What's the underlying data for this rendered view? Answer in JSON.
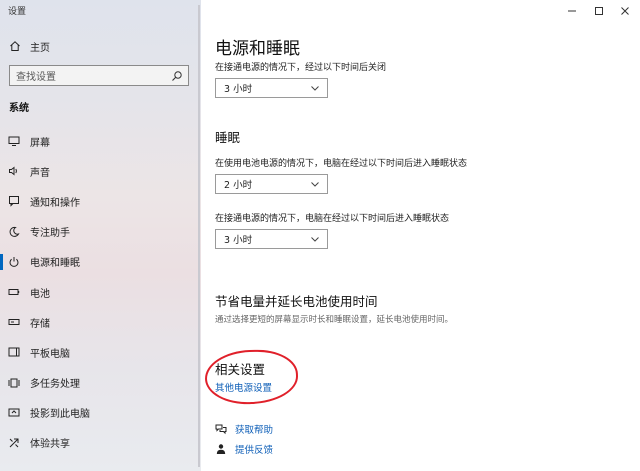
{
  "app": {
    "title": "设置"
  },
  "sidebar": {
    "home_label": "主页",
    "search_placeholder": "查找设置",
    "section_label": "系统",
    "items": [
      {
        "label": "屏幕",
        "icon": "monitor-icon"
      },
      {
        "label": "声音",
        "icon": "speaker-icon"
      },
      {
        "label": "通知和操作",
        "icon": "notification-icon"
      },
      {
        "label": "专注助手",
        "icon": "moon-icon"
      },
      {
        "label": "电源和睡眠",
        "icon": "power-icon",
        "active": true
      },
      {
        "label": "电池",
        "icon": "battery-icon"
      },
      {
        "label": "存储",
        "icon": "storage-icon"
      },
      {
        "label": "平板电脑",
        "icon": "tablet-icon"
      },
      {
        "label": "多任务处理",
        "icon": "multitask-icon"
      },
      {
        "label": "投影到此电脑",
        "icon": "project-icon"
      },
      {
        "label": "体验共享",
        "icon": "share-icon"
      }
    ]
  },
  "main": {
    "title": "电源和睡眠",
    "screen_desc": "在接通电源的情况下，经过以下时间后关闭",
    "screen_value": "3 小时",
    "sleep_heading": "睡眠",
    "sleep_battery_desc": "在使用电池电源的情况下，电脑在经过以下时间后进入睡眠状态",
    "sleep_battery_value": "2 小时",
    "sleep_plugged_desc": "在接通电源的情况下，电脑在经过以下时间后进入睡眠状态",
    "sleep_plugged_value": "3 小时",
    "save_heading": "节省电量并延长电池使用时间",
    "save_desc": "通过选择更短的屏幕显示时长和睡眠设置，延长电池使用时间。",
    "related_heading": "相关设置",
    "related_link": "其他电源设置",
    "help_label": "获取帮助",
    "feedback_label": "提供反馈"
  },
  "colors": {
    "accent": "#0067c0",
    "link": "#1060b8",
    "annotation": "#e0202a"
  }
}
